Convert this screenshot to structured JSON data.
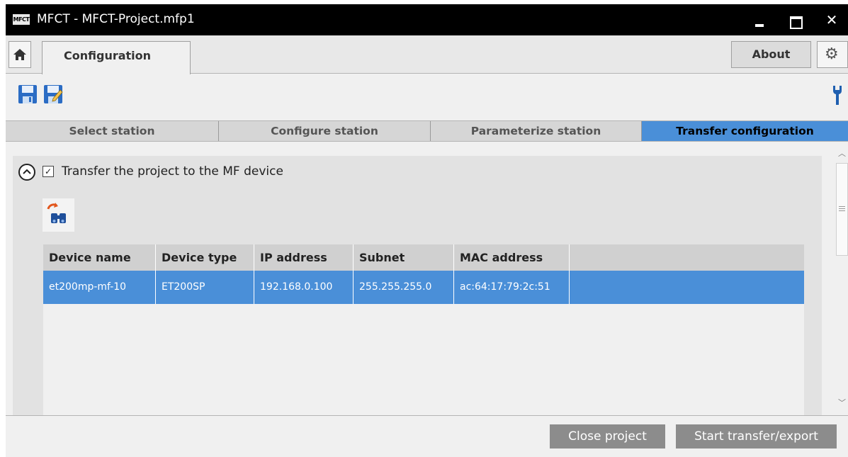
{
  "window": {
    "logo_text": "MFCT",
    "title": "MFCT - MFCT-Project.mfp1",
    "close_glyph": "✕"
  },
  "menu": {
    "home_icon": "home-icon",
    "config_tab": "Configuration",
    "about": "About",
    "settings_icon": "gear-icon"
  },
  "toolbar": {
    "save_icon": "save-icon",
    "save_as_icon": "save-as-icon",
    "tools_icon": "wrench-icon"
  },
  "steps": [
    "Select station",
    "Configure station",
    "Parameterize station",
    "Transfer configuration"
  ],
  "active_step": 3,
  "transfer": {
    "checkbox_checked": true,
    "check_glyph": "✓",
    "checkbox_label": "Transfer the project to the MF device"
  },
  "table": {
    "headers": [
      "Device name",
      "Device type",
      "IP address",
      "Subnet",
      "MAC address",
      ""
    ],
    "rows": [
      [
        "et200mp-mf-10",
        "ET200SP",
        "192.168.0.100",
        "255.255.255.0",
        "ac:64:17:79:2c:51",
        ""
      ]
    ]
  },
  "footer": {
    "close_project": "Close project",
    "start_transfer": "Start transfer/export"
  },
  "colors": {
    "accent": "#4a8fd8",
    "titlebar": "#000000",
    "button_gray": "#8c8c8c"
  }
}
